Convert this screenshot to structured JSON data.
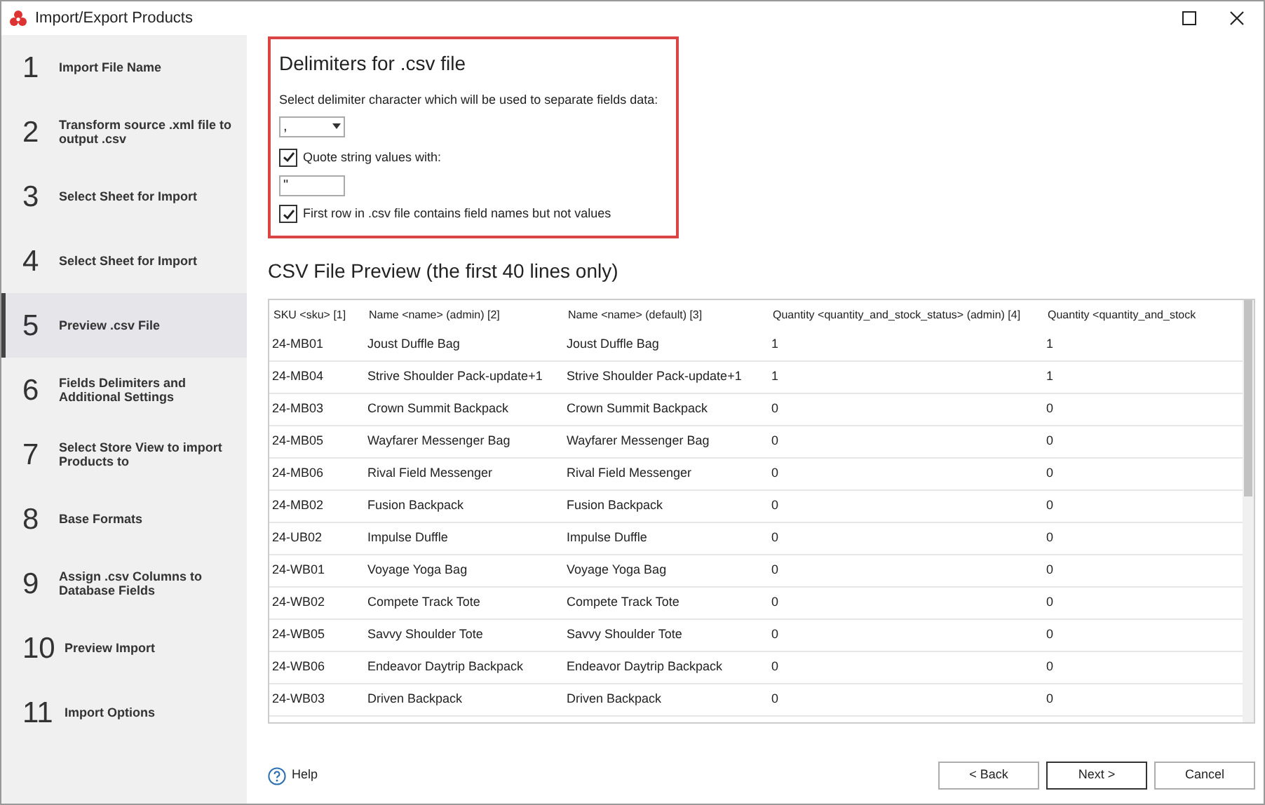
{
  "window": {
    "title": "Import/Export Products"
  },
  "steps": [
    {
      "number": "1",
      "label": "Import File Name",
      "selected": false
    },
    {
      "number": "2",
      "label": "Transform source .xml file to output .csv",
      "selected": false
    },
    {
      "number": "3",
      "label": "Select Sheet for Import",
      "selected": false
    },
    {
      "number": "4",
      "label": "Select Sheet for Import",
      "selected": false
    },
    {
      "number": "5",
      "label": "Preview .csv File",
      "selected": true
    },
    {
      "number": "6",
      "label": "Fields Delimiters and Additional Settings",
      "selected": false
    },
    {
      "number": "7",
      "label": "Select Store View to import Products to",
      "selected": false
    },
    {
      "number": "8",
      "label": "Base Formats",
      "selected": false
    },
    {
      "number": "9",
      "label": "Assign .csv Columns to Database Fields",
      "selected": false
    },
    {
      "number": "10",
      "label": "Preview Import",
      "selected": false
    },
    {
      "number": "11",
      "label": "Import Options",
      "selected": false
    }
  ],
  "delimiters": {
    "title": "Delimiters for .csv file",
    "prompt": "Select delimiter character which will be used to separate fields data:",
    "delimiter_value": ",",
    "quote": {
      "label": "Quote string values with:",
      "checked": true
    },
    "quote_value": "\"",
    "first_row": {
      "label": "First row in .csv file contains field names but not values",
      "checked": true
    }
  },
  "preview": {
    "title": "CSV File Preview (the first 40 lines only)",
    "columns": [
      "SKU <sku> [1]",
      "Name <name> (admin) [2]",
      "Name <name> (default) [3]",
      "Quantity <quantity_and_stock_status> (admin) [4]",
      "Quantity <quantity_and_stock"
    ],
    "rows": [
      [
        "24-MB01",
        "Joust Duffle Bag",
        "Joust Duffle Bag",
        "1",
        "1"
      ],
      [
        "24-MB04",
        "Strive Shoulder Pack-update+1",
        "Strive Shoulder Pack-update+1",
        "1",
        "1"
      ],
      [
        "24-MB03",
        "Crown Summit Backpack",
        "Crown Summit Backpack",
        "0",
        "0"
      ],
      [
        "24-MB05",
        "Wayfarer Messenger Bag",
        "Wayfarer Messenger Bag",
        "0",
        "0"
      ],
      [
        "24-MB06",
        "Rival Field Messenger",
        "Rival Field Messenger",
        "0",
        "0"
      ],
      [
        "24-MB02",
        "Fusion Backpack",
        "Fusion Backpack",
        "0",
        "0"
      ],
      [
        "24-UB02",
        "Impulse Duffle",
        "Impulse Duffle",
        "0",
        "0"
      ],
      [
        "24-WB01",
        "Voyage Yoga Bag",
        "Voyage Yoga Bag",
        "0",
        "0"
      ],
      [
        "24-WB02",
        "Compete Track Tote",
        "Compete Track Tote",
        "0",
        "0"
      ],
      [
        "24-WB05",
        "Savvy Shoulder Tote",
        "Savvy Shoulder Tote",
        "0",
        "0"
      ],
      [
        "24-WB06",
        "Endeavor Daytrip Backpack",
        "Endeavor Daytrip Backpack",
        "0",
        "0"
      ],
      [
        "24-WB03",
        "Driven Backpack",
        "Driven Backpack",
        "0",
        "0"
      ]
    ]
  },
  "help": "Help",
  "buttons": [
    {
      "label": "< Back",
      "default": false
    },
    {
      "label": "Next >",
      "default": true
    },
    {
      "label": "Cancel",
      "default": false
    }
  ]
}
